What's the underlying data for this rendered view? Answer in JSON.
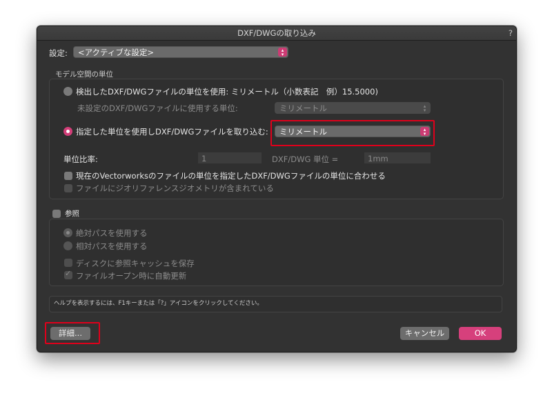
{
  "dialog": {
    "title": "DXF/DWGの取り込み",
    "help_glyph": "?"
  },
  "settings": {
    "label": "設定:",
    "value": "<アクティブな設定>"
  },
  "model_units": {
    "group_title": "モデル空間の単位",
    "radio_detected_label": "検出したDXF/DWGファイルの単位を使用:  ミリメートル（小数表記　例）15.5000)",
    "unset_units_label": "未設定のDXF/DWGファイルに使用する単位:",
    "unset_units_value": "ミリメートル",
    "radio_specified_label": "指定した単位を使用しDXF/DWGファイルを取り込む:",
    "specified_units_value": "ミリメートル",
    "scale_label": "単位比率:",
    "scale_value": "1",
    "dxf_unit_label": "DXF/DWG 単位 =",
    "dxf_unit_value": "1mm",
    "check_match_label": "現在のVectorworksのファイルの単位を指定したDXF/DWGファイルの単位に合わせる",
    "check_georef_label": "ファイルにジオリファレンスジオメトリが含まれている"
  },
  "reference": {
    "label": "参照",
    "radio_absolute": "絶対パスを使用する",
    "radio_relative": "相対パスを使用する",
    "check_cache": "ディスクに参照キャッシュを保存",
    "check_autoupdate": "ファイルオープン時に自動更新"
  },
  "help_text": "ヘルプを表示するには、F1キーまたは「?」アイコンをクリックしてください。",
  "buttons": {
    "details": "詳細...",
    "cancel": "キャンセル",
    "ok": "OK"
  },
  "colors": {
    "accent": "#d6407c",
    "annotation_red": "#e0001b",
    "dialog_bg": "#323232"
  }
}
